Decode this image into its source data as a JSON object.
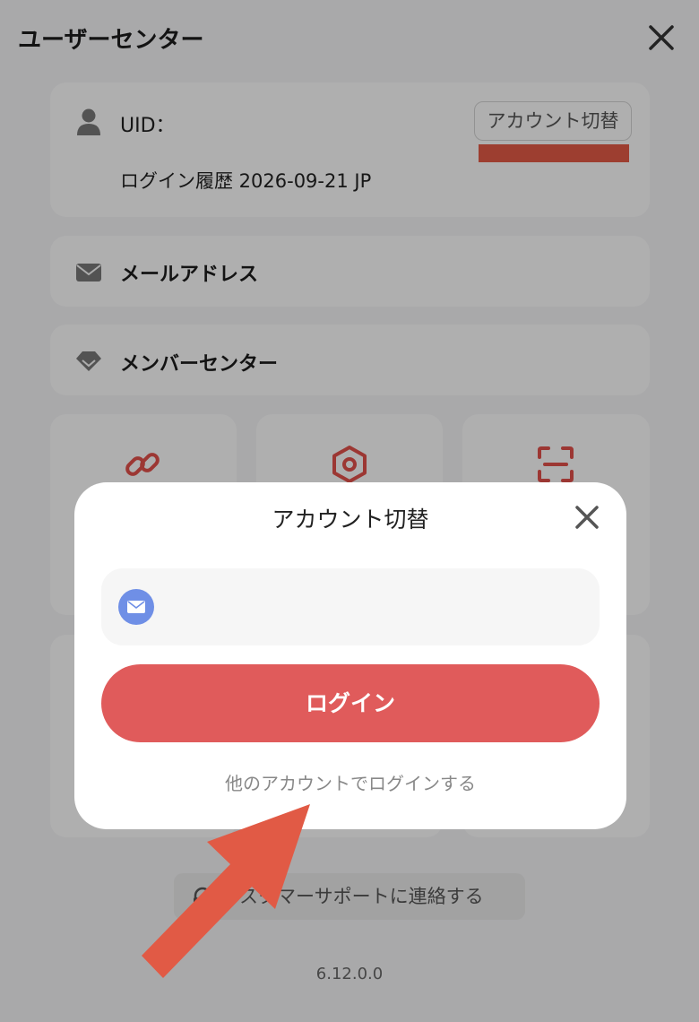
{
  "header": {
    "title": "ユーザーセンター"
  },
  "user_card": {
    "uid_label": "UID：",
    "switch_label": "アカウント切替",
    "login_history": "ログイン履歴 2026-09-21 JP"
  },
  "rows": {
    "email_label": "メールアドレス",
    "member_label": "メンバーセンター"
  },
  "tiles": {
    "icons": [
      "link-icon",
      "settings-hexagon-icon",
      "scan-icon"
    ]
  },
  "footer": {
    "support_label": "カスタマーサポートに連絡する",
    "version": "6.12.0.0"
  },
  "modal": {
    "title": "アカウント切替",
    "email_value": "",
    "login_label": "ログイン",
    "other_login": "他のアカウントでログインする"
  },
  "colors": {
    "accent": "#e05b5b",
    "annotation": "#e15a45",
    "mail_badge": "#6f8fe6"
  }
}
